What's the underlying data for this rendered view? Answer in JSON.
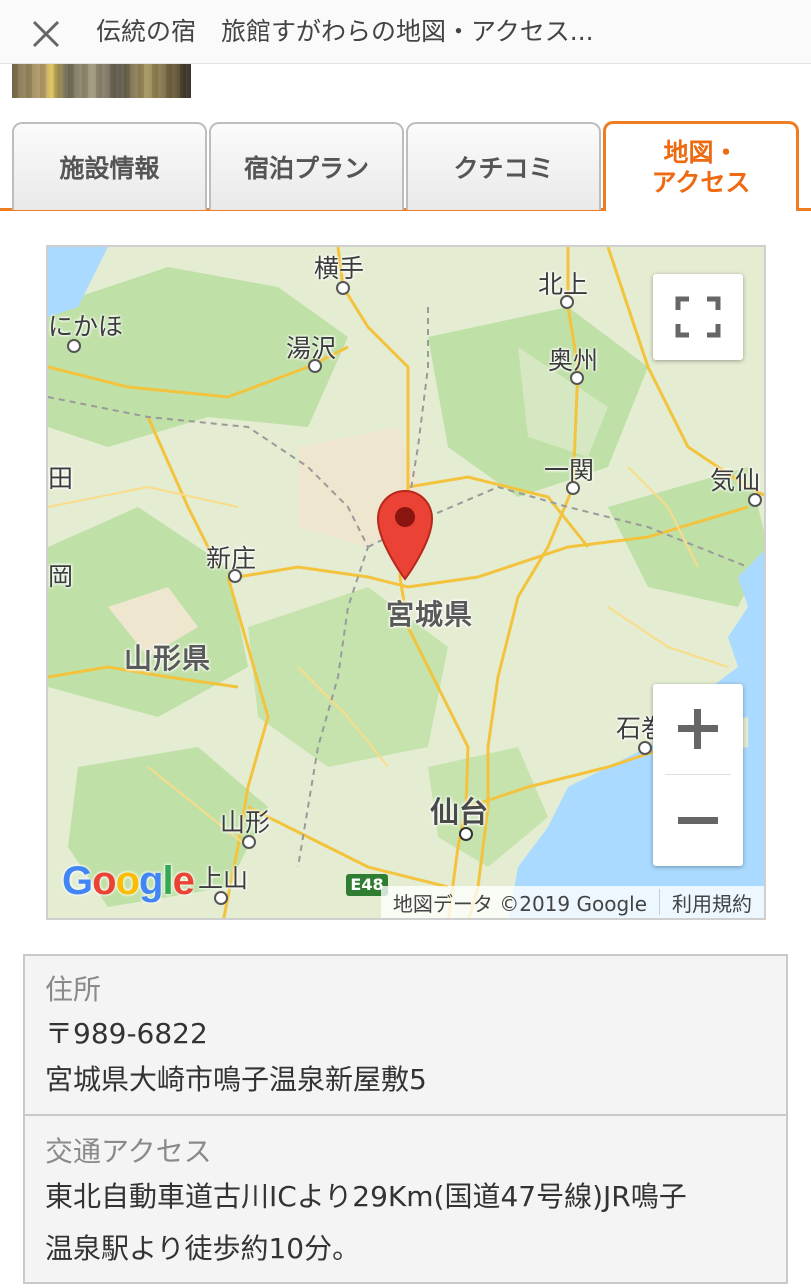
{
  "header": {
    "title": "伝統の宿　旅館すがわらの地図・アクセス..."
  },
  "tabs": [
    {
      "label": "施設情報",
      "active": false
    },
    {
      "label": "宿泊プラン",
      "active": false
    },
    {
      "label": "クチコミ",
      "active": false
    },
    {
      "label_line1": "地図・",
      "label_line2": "アクセス",
      "active": true
    }
  ],
  "map": {
    "labels": {
      "yokote": "横手",
      "kitakami": "北上",
      "nikaho": "にかほ",
      "yuzawa": "湯沢",
      "oshu": "奥州",
      "ta": "田",
      "ichinoseki": "一関",
      "kesennuma": "気仙",
      "shinjo": "新庄",
      "oka": "岡",
      "miyagi_pref": "宮城県",
      "yamagata_pref": "山形県",
      "ishinomaki": "石巻",
      "sendai": "仙台",
      "yamagata": "山形",
      "kaminoyama": "上山"
    },
    "route_badge": "E48",
    "logo": "Google",
    "attribution": "地図データ ©2019 Google",
    "terms": "利用規約",
    "colors": {
      "water": "#aadaff",
      "land": "#dfeccd",
      "forest": "#b9dca0",
      "road": "#f7cf57",
      "pin": "#ea4335"
    }
  },
  "info": {
    "address_label": "住所",
    "postal_code": "〒989-6822",
    "address": "宮城県大崎市鳴子温泉新屋敷5",
    "access_label": "交通アクセス",
    "access_line1": "東北自動車道古川ICより29Km(国道47号線)JR鳴子",
    "access_line2": "温泉駅より徒歩約10分。"
  }
}
